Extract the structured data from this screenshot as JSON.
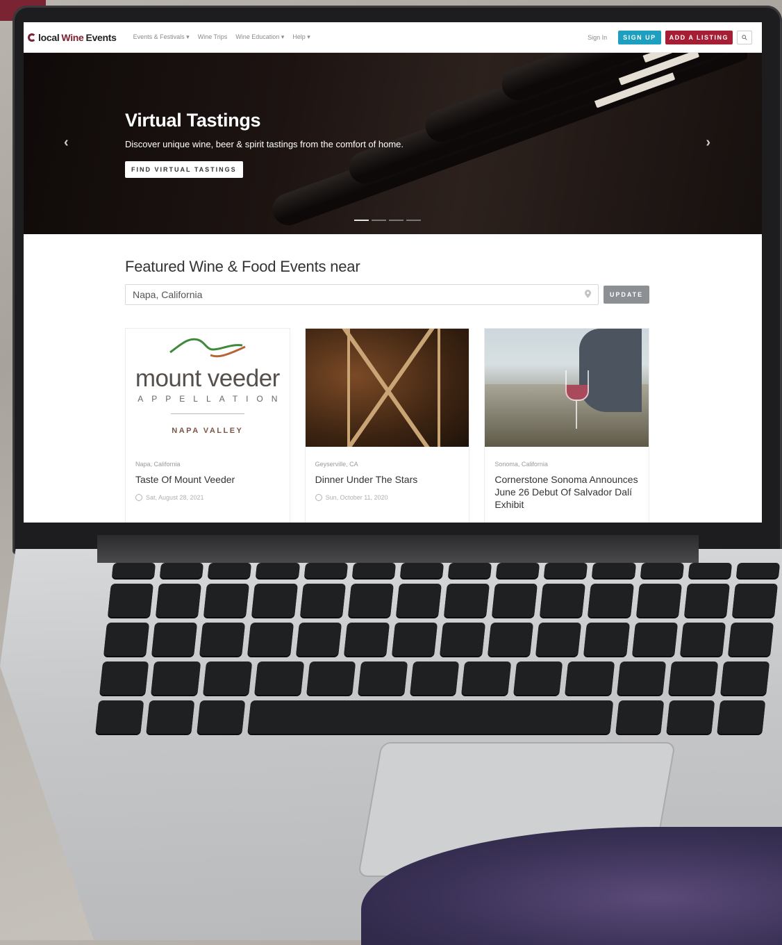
{
  "navbar": {
    "logo_prefix": "local",
    "logo_wine": "Wine",
    "logo_suffix": "Events",
    "links": [
      "Events & Festivals ▾",
      "Wine Trips",
      "Wine Education ▾",
      "Help ▾"
    ],
    "sign_in": "Sign In",
    "sign_up": "SIGN UP",
    "add_listing": "ADD A LISTING",
    "search_icon": "search-icon"
  },
  "hero": {
    "title": "Virtual Tastings",
    "subtitle": "Discover unique wine, beer & spirit tastings from the comfort of home.",
    "button": "FIND VIRTUAL TASTINGS",
    "prev_arrow": "‹",
    "next_arrow": "›"
  },
  "featured": {
    "title": "Featured Wine & Food Events near",
    "location_value": "Napa, California",
    "update_button": "UPDATE"
  },
  "cards": [
    {
      "logo_name": "mount veeder",
      "logo_appellation": "APPELLATION",
      "logo_region": "NAPA VALLEY",
      "location": "Napa, California",
      "title": "Taste Of Mount Veeder",
      "date": "Sat, August 28, 2021"
    },
    {
      "location": "Geyserville, CA",
      "title": "Dinner Under The Stars",
      "date": "Sun, October 11, 2020"
    },
    {
      "location": "Sonoma, California",
      "title": "Cornerstone Sonoma Announces June 26 Debut Of Salvador Dalí Exhibit",
      "date": ""
    }
  ],
  "colors": {
    "brand": "#7a2333",
    "signup": "#1d9fc0",
    "listing": "#a51e34"
  }
}
